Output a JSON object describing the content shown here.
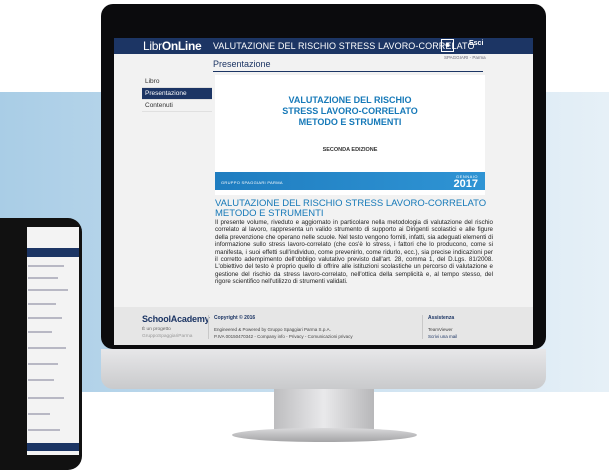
{
  "app": {
    "logo_left": "Libr",
    "logo_right": "OnLine",
    "header_title": "VALUTAZIONE DEL RISCHIO STRESS LAVORO-CORRELATO",
    "user_icon": "user-icon",
    "exit_label": "Esci",
    "user_line": "SPAGGIARI - Parma"
  },
  "page_title": "Presentazione",
  "sidebar": {
    "items": [
      {
        "label": "Libro"
      },
      {
        "label": "Presentazione"
      },
      {
        "label": "Contenuti"
      }
    ]
  },
  "cover": {
    "title_1": "VALUTAZIONE DEL RISCHIO",
    "title_2": "STRESS LAVORO-CORRELATO",
    "title_3": "METODO E STRUMENTI",
    "edition": "SECONDA EDIZIONE",
    "publisher": "GRUPPO SPAGGIARI PARMA",
    "month": "GENNAIO",
    "year": "2017"
  },
  "description": {
    "title": "VALUTAZIONE DEL RISCHIO STRESS LAVORO-CORRELATO METODO E STRUMENTI",
    "body": "Il presente volume, riveduto e aggiornato in particolare nella metodologia di valutazione del rischio correlato al lavoro, rappresenta un valido strumento di supporto ai Dirigenti scolastici e alle figure della prevenzione che operano nelle scuole. Nel testo vengono forniti, infatti, sia adeguati elementi di informazione sullo stress lavoro-correlato (che cos'è lo stress, i fattori che lo producono, come si manifesta, i suoi effetti sull'individuo, come prevenirlo, come ridurlo, ecc.), sia precise indicazioni per il corretto adempimento dell'obbligo valutativo previsto dall'art. 28, comma 1, del D.Lgs. 81/2008. L'obiettivo del testo è proprio quello di offrire alle istituzioni scolastiche un percorso di valutazione e gestione del rischio da stress lavoro-correlato, nell'ottica della semplicità e, al tempo stesso, del rigore scientifico nell'utilizzo di strumenti validati."
  },
  "footer": {
    "brand": "SchoolAcademy",
    "project_prefix": "È un progetto",
    "project_owner": "GruppoSpaggiariParma",
    "copyright": "Copyright © 2016",
    "engineered": "Engineered & Powered by Gruppo Spaggiari Parma S.p.A.",
    "piva_links": "P.IVA 00150470342 - Company info - Privacy - Comunicazioni privacy",
    "assist_title": "Assistenza",
    "teamviewer": "TeamViewer",
    "write_mail": "Scrivi una mail"
  },
  "device_icons": {
    "apple": "apple-logo-icon"
  }
}
